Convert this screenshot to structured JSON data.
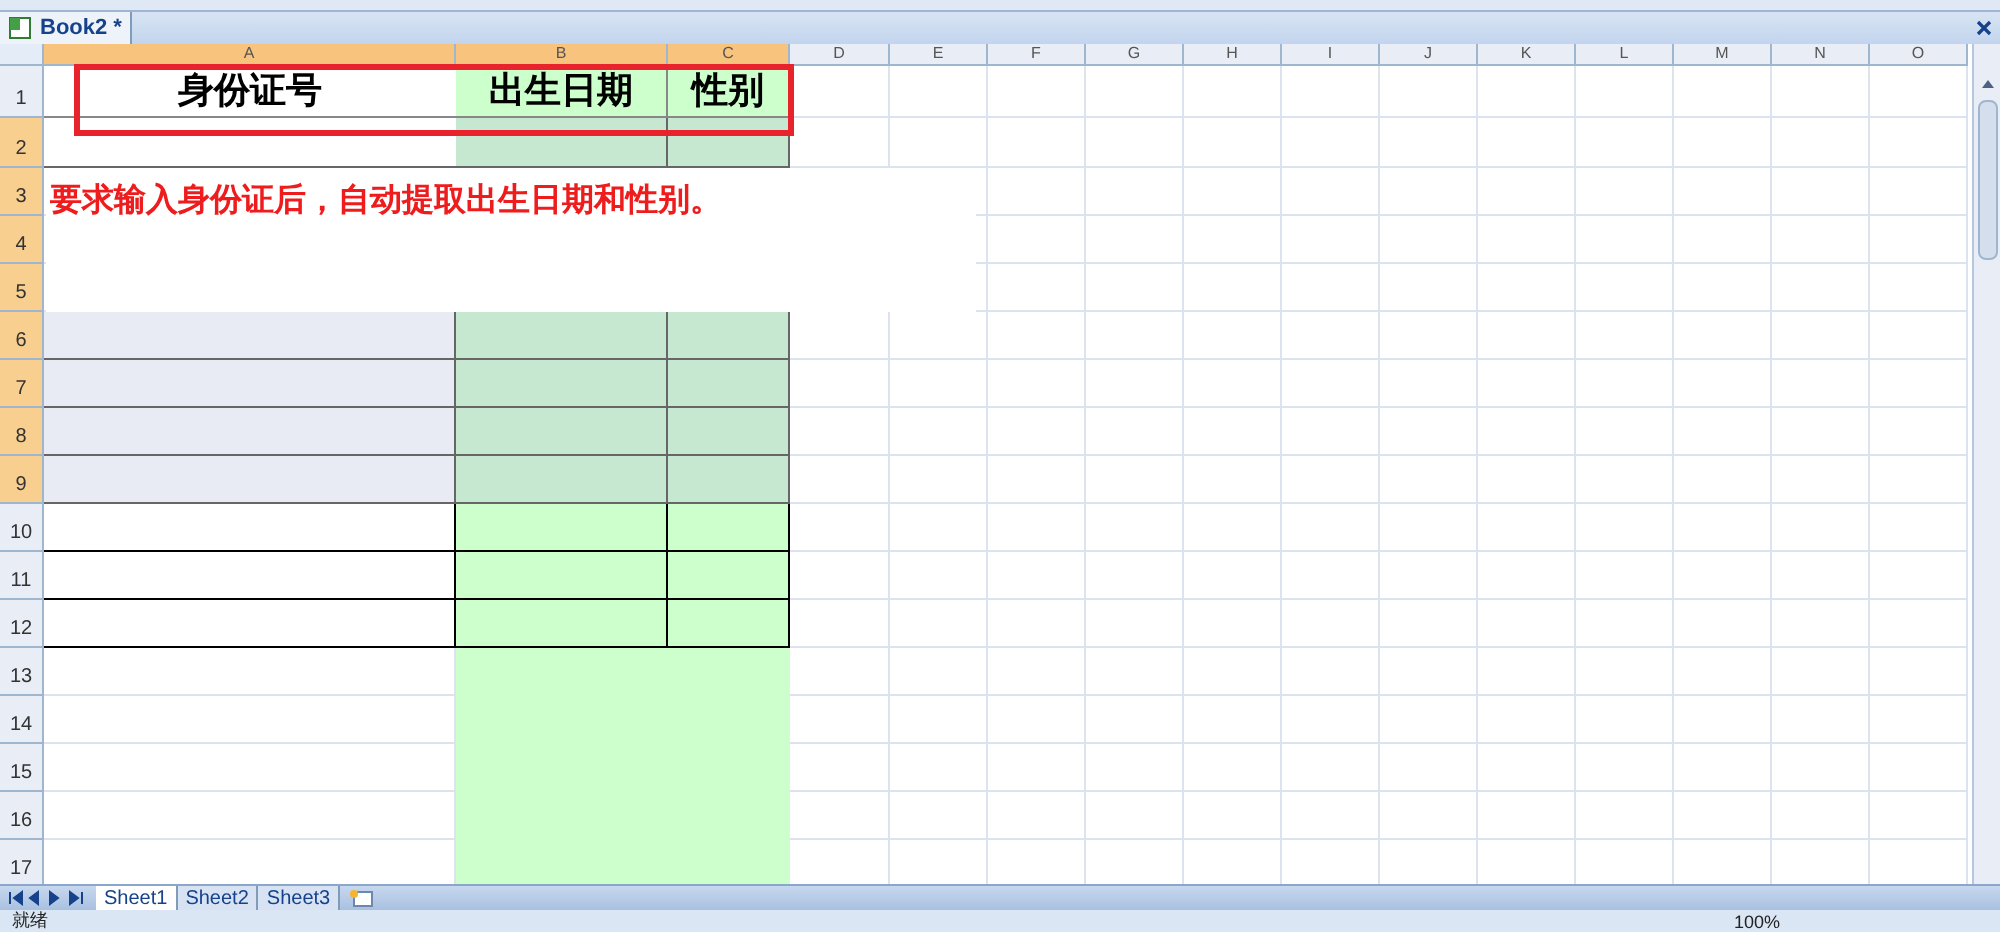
{
  "document_tab": {
    "title": "Book2 *"
  },
  "columns": [
    {
      "label": "A",
      "selected": true
    },
    {
      "label": "B",
      "selected": true
    },
    {
      "label": "C",
      "selected": true
    },
    {
      "label": "D",
      "selected": false
    },
    {
      "label": "E",
      "selected": false
    },
    {
      "label": "F",
      "selected": false
    },
    {
      "label": "G",
      "selected": false
    },
    {
      "label": "H",
      "selected": false
    },
    {
      "label": "I",
      "selected": false
    },
    {
      "label": "J",
      "selected": false
    },
    {
      "label": "K",
      "selected": false
    },
    {
      "label": "L",
      "selected": false
    },
    {
      "label": "M",
      "selected": false
    },
    {
      "label": "N",
      "selected": false
    },
    {
      "label": "O",
      "selected": false
    }
  ],
  "rows": [
    {
      "number": "1",
      "kind": "title",
      "selected": false,
      "cells": [
        "身份证号",
        "出生日期",
        "性别"
      ]
    },
    {
      "number": "2",
      "kind": "entry",
      "selected": true
    },
    {
      "number": "3",
      "kind": "note",
      "selected": true
    },
    {
      "number": "4",
      "kind": "note",
      "selected": true
    },
    {
      "number": "5",
      "kind": "note",
      "selected": true
    },
    {
      "number": "6",
      "kind": "marked",
      "selected": true
    },
    {
      "number": "7",
      "kind": "marked",
      "selected": true
    },
    {
      "number": "8",
      "kind": "marked",
      "selected": true
    },
    {
      "number": "9",
      "kind": "marked",
      "selected": true
    },
    {
      "number": "10",
      "kind": "table",
      "selected": false
    },
    {
      "number": "11",
      "kind": "table",
      "selected": false
    },
    {
      "number": "12",
      "kind": "table",
      "selected": false
    },
    {
      "number": "13",
      "kind": "fill",
      "selected": false
    },
    {
      "number": "14",
      "kind": "fill",
      "selected": false
    },
    {
      "number": "15",
      "kind": "fill",
      "selected": false
    },
    {
      "number": "16",
      "kind": "fill",
      "selected": false
    },
    {
      "number": "17",
      "kind": "fill",
      "selected": false
    }
  ],
  "note": "要求输入身份证后，自动提取出生日期和性别。",
  "sheet_tabs": [
    {
      "label": "Sheet1",
      "selected": true
    },
    {
      "label": "Sheet2",
      "selected": false
    },
    {
      "label": "Sheet3",
      "selected": false
    }
  ],
  "status_bar": {
    "status": "就绪",
    "zoom": "100%"
  }
}
